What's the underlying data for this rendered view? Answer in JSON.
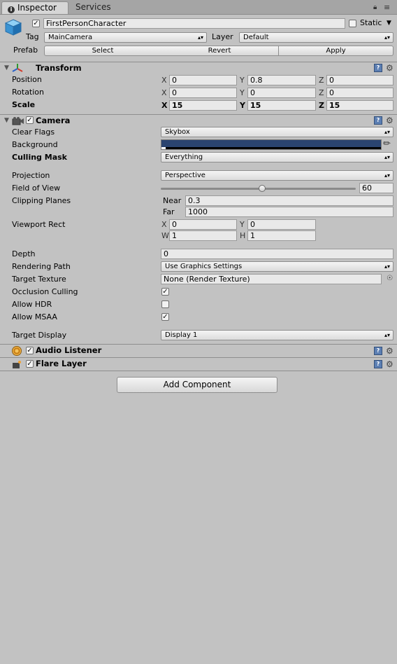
{
  "tabs": {
    "inspector": "Inspector",
    "services": "Services"
  },
  "header": {
    "object_name": "FirstPersonCharacter",
    "static_label": "Static",
    "tag_label": "Tag",
    "tag_value": "MainCamera",
    "layer_label": "Layer",
    "layer_value": "Default",
    "prefab_label": "Prefab",
    "prefab_select": "Select",
    "prefab_revert": "Revert",
    "prefab_apply": "Apply"
  },
  "transform": {
    "title": "Transform",
    "position_label": "Position",
    "rotation_label": "Rotation",
    "scale_label": "Scale",
    "position": {
      "x": "0",
      "y": "0.8",
      "z": "0"
    },
    "rotation": {
      "x": "0",
      "y": "0",
      "z": "0"
    },
    "scale": {
      "x": "15",
      "y": "15",
      "z": "15"
    }
  },
  "axes": {
    "x": "X",
    "y": "Y",
    "z": "Z",
    "w": "W",
    "h": "H"
  },
  "camera": {
    "title": "Camera",
    "clear_flags_label": "Clear Flags",
    "clear_flags_value": "Skybox",
    "background_label": "Background",
    "background_color": "#2a4470",
    "culling_mask_label": "Culling Mask",
    "culling_mask_value": "Everything",
    "projection_label": "Projection",
    "projection_value": "Perspective",
    "fov_label": "Field of View",
    "fov_value": "60",
    "fov_fraction": 0.52,
    "clipping_label": "Clipping Planes",
    "near_label": "Near",
    "near_value": "0.3",
    "far_label": "Far",
    "far_value": "1000",
    "viewport_label": "Viewport Rect",
    "viewport": {
      "x": "0",
      "y": "0",
      "w": "1",
      "h": "1"
    },
    "depth_label": "Depth",
    "depth_value": "0",
    "rendering_path_label": "Rendering Path",
    "rendering_path_value": "Use Graphics Settings",
    "target_texture_label": "Target Texture",
    "target_texture_value": "None (Render Texture)",
    "occlusion_label": "Occlusion Culling",
    "occlusion_checked": true,
    "hdr_label": "Allow HDR",
    "hdr_checked": false,
    "msaa_label": "Allow MSAA",
    "msaa_checked": true,
    "target_display_label": "Target Display",
    "target_display_value": "Display 1"
  },
  "audio_listener": {
    "title": "Audio Listener"
  },
  "flare_layer": {
    "title": "Flare Layer"
  },
  "add_component": "Add Component"
}
